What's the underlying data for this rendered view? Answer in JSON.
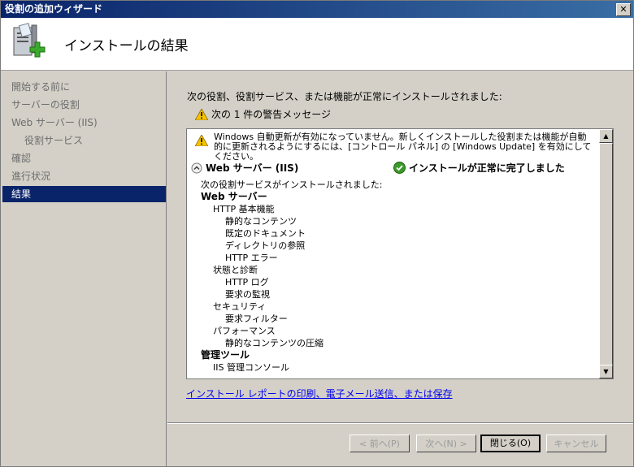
{
  "window": {
    "title": "役割の追加ウィザード",
    "close_label": "✕"
  },
  "header": {
    "title": "インストールの結果",
    "icon": "server-add-icon"
  },
  "sidebar": {
    "items": [
      {
        "label": "開始する前に",
        "state": "inactive"
      },
      {
        "label": "サーバーの役割",
        "state": "inactive"
      },
      {
        "label": "Web サーバー (IIS)",
        "state": "inactive"
      },
      {
        "label": "役割サービス",
        "state": "inactive",
        "sub": true
      },
      {
        "label": "確認",
        "state": "inactive"
      },
      {
        "label": "進行状況",
        "state": "inactive"
      },
      {
        "label": "結果",
        "state": "active"
      }
    ]
  },
  "main": {
    "intro": "次の役割、役割サービス、または機能が正常にインストールされました:",
    "warning_summary": "次の 1 件の警告メッセージ",
    "results": {
      "warning_text": "Windows 自動更新が有効になっていません。新しくインストールした役割または機能が自動的に更新されるようにするには、[コントロール パネル] の [Windows Update] を有効にしてください。",
      "section_title": "Web サーバー (IIS)",
      "section_status": "インストールが正常に完了しました",
      "tree": [
        {
          "text": "次の役割サービスがインストールされました:",
          "level": 1,
          "bold": false
        },
        {
          "text": "Web サーバー",
          "level": 1,
          "bold": true
        },
        {
          "text": "HTTP 基本機能",
          "level": 2,
          "bold": false
        },
        {
          "text": "静的なコンテンツ",
          "level": 3,
          "bold": false
        },
        {
          "text": "既定のドキュメント",
          "level": 3,
          "bold": false
        },
        {
          "text": "ディレクトリの参照",
          "level": 3,
          "bold": false
        },
        {
          "text": "HTTP エラー",
          "level": 3,
          "bold": false
        },
        {
          "text": "状態と診断",
          "level": 2,
          "bold": false
        },
        {
          "text": "HTTP ログ",
          "level": 3,
          "bold": false
        },
        {
          "text": "要求の監視",
          "level": 3,
          "bold": false
        },
        {
          "text": "セキュリティ",
          "level": 2,
          "bold": false
        },
        {
          "text": "要求フィルター",
          "level": 3,
          "bold": false
        },
        {
          "text": "パフォーマンス",
          "level": 2,
          "bold": false
        },
        {
          "text": "静的なコンテンツの圧縮",
          "level": 3,
          "bold": false
        },
        {
          "text": "管理ツール",
          "level": 1,
          "bold": true
        },
        {
          "text": "IIS 管理コンソール",
          "level": 2,
          "bold": false
        }
      ]
    },
    "report_link": "インストール レポートの印刷、電子メール送信、または保存"
  },
  "footer": {
    "prev": "< 前へ(P)",
    "next": "次へ(N) >",
    "close": "閉じる(O)",
    "cancel": "キャンセル"
  },
  "colors": {
    "title_bar": "#0a246a",
    "selected_nav": "#0a246a",
    "link": "#0000ee",
    "ok_green": "#3a9a2a",
    "warn_yellow": "#f5c400"
  }
}
